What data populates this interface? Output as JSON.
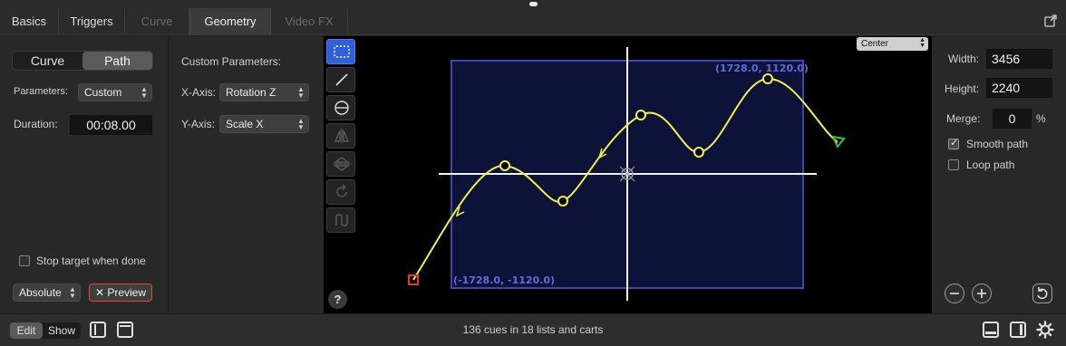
{
  "tabs": [
    {
      "label": "Basics",
      "state": "normal"
    },
    {
      "label": "Triggers",
      "state": "normal"
    },
    {
      "label": "Curve",
      "state": "disabled"
    },
    {
      "label": "Geometry",
      "state": "active"
    },
    {
      "label": "Video FX",
      "state": "disabled"
    }
  ],
  "left": {
    "mode_curve": "Curve",
    "mode_path": "Path",
    "parameters_label": "Parameters:",
    "parameters_value": "Custom",
    "duration_label": "Duration:",
    "duration_value": "00:08.00",
    "stop_target_label": "Stop target when done",
    "stop_target_checked": false,
    "absolute_value": "Absolute",
    "preview_label": "✕ Preview"
  },
  "mid": {
    "custom_params_label": "Custom Parameters:",
    "x_axis_label": "X-Axis:",
    "x_axis_value": "Rotation Z",
    "y_axis_label": "Y-Axis:",
    "y_axis_value": "Scale X"
  },
  "canvas": {
    "tools": [
      "select-rect-icon",
      "line-icon",
      "ellipse-icon",
      "flip-horizontal-icon",
      "flip-vertical-icon",
      "rotate-icon",
      "path-reverse-icon"
    ],
    "anchor_value": "Center",
    "max_corner": "(1728.0, 1120.0)",
    "min_corner": "(-1728.0, -1120.0)",
    "help_label": "?"
  },
  "right": {
    "width_label": "Width:",
    "width_value": "3456",
    "height_label": "Height:",
    "height_value": "2240",
    "merge_label": "Merge:",
    "merge_value": "0",
    "merge_unit": "%",
    "smooth_label": "Smooth path",
    "smooth_checked": true,
    "loop_label": "Loop path",
    "loop_checked": false
  },
  "bottom": {
    "edit_label": "Edit",
    "show_label": "Show",
    "status_text": "136 cues in 18 lists and carts"
  },
  "colors": {
    "accent": "#2f60d8",
    "path": "#f2f04a",
    "bounds": "#3a48b0",
    "bounds_fill": "#0c1238",
    "start_marker": "#e03a2a",
    "end_marker": "#38c24a"
  }
}
